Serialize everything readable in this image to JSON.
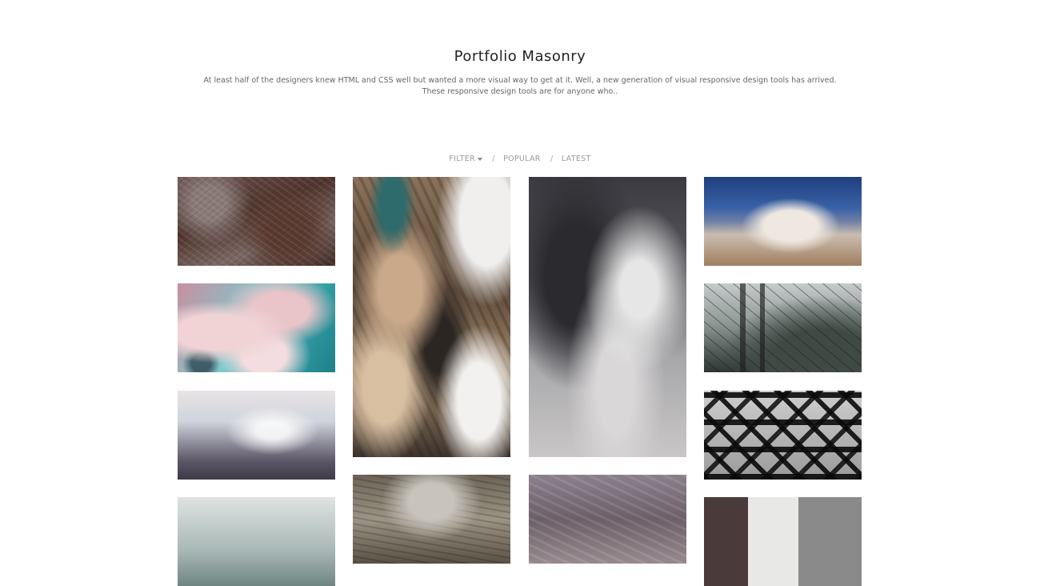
{
  "header": {
    "title": "Portfolio Masonry",
    "description_line1": "At least half of the designers knew HTML and CSS well but wanted a more visual way to get at it. Well, a new generation of visual responsive design tools has arrived.",
    "description_line2": "These responsive design tools are for anyone who.."
  },
  "filters": {
    "filter_label": "FILTER",
    "separator": "/",
    "popular_label": "POPULAR",
    "latest_label": "LATEST",
    "dropdown_icon": "caret-down-icon"
  },
  "gallery": {
    "columns": 4,
    "tiles": [
      {
        "name": "aerial-city",
        "column": 1
      },
      {
        "name": "pink-water-abstract",
        "column": 1
      },
      {
        "name": "hazy-valley",
        "column": 1
      },
      {
        "name": "coastal-landscape",
        "column": 1
      },
      {
        "name": "aerial-terrain",
        "column": 2
      },
      {
        "name": "driftwood",
        "column": 2
      },
      {
        "name": "storm-clouds",
        "column": 3
      },
      {
        "name": "canyon-aerial",
        "column": 3
      },
      {
        "name": "mountain-above-clouds",
        "column": 4
      },
      {
        "name": "transmission-tower",
        "column": 4
      },
      {
        "name": "steel-bridge",
        "column": 4
      },
      {
        "name": "wall-corner",
        "column": 4
      }
    ]
  }
}
